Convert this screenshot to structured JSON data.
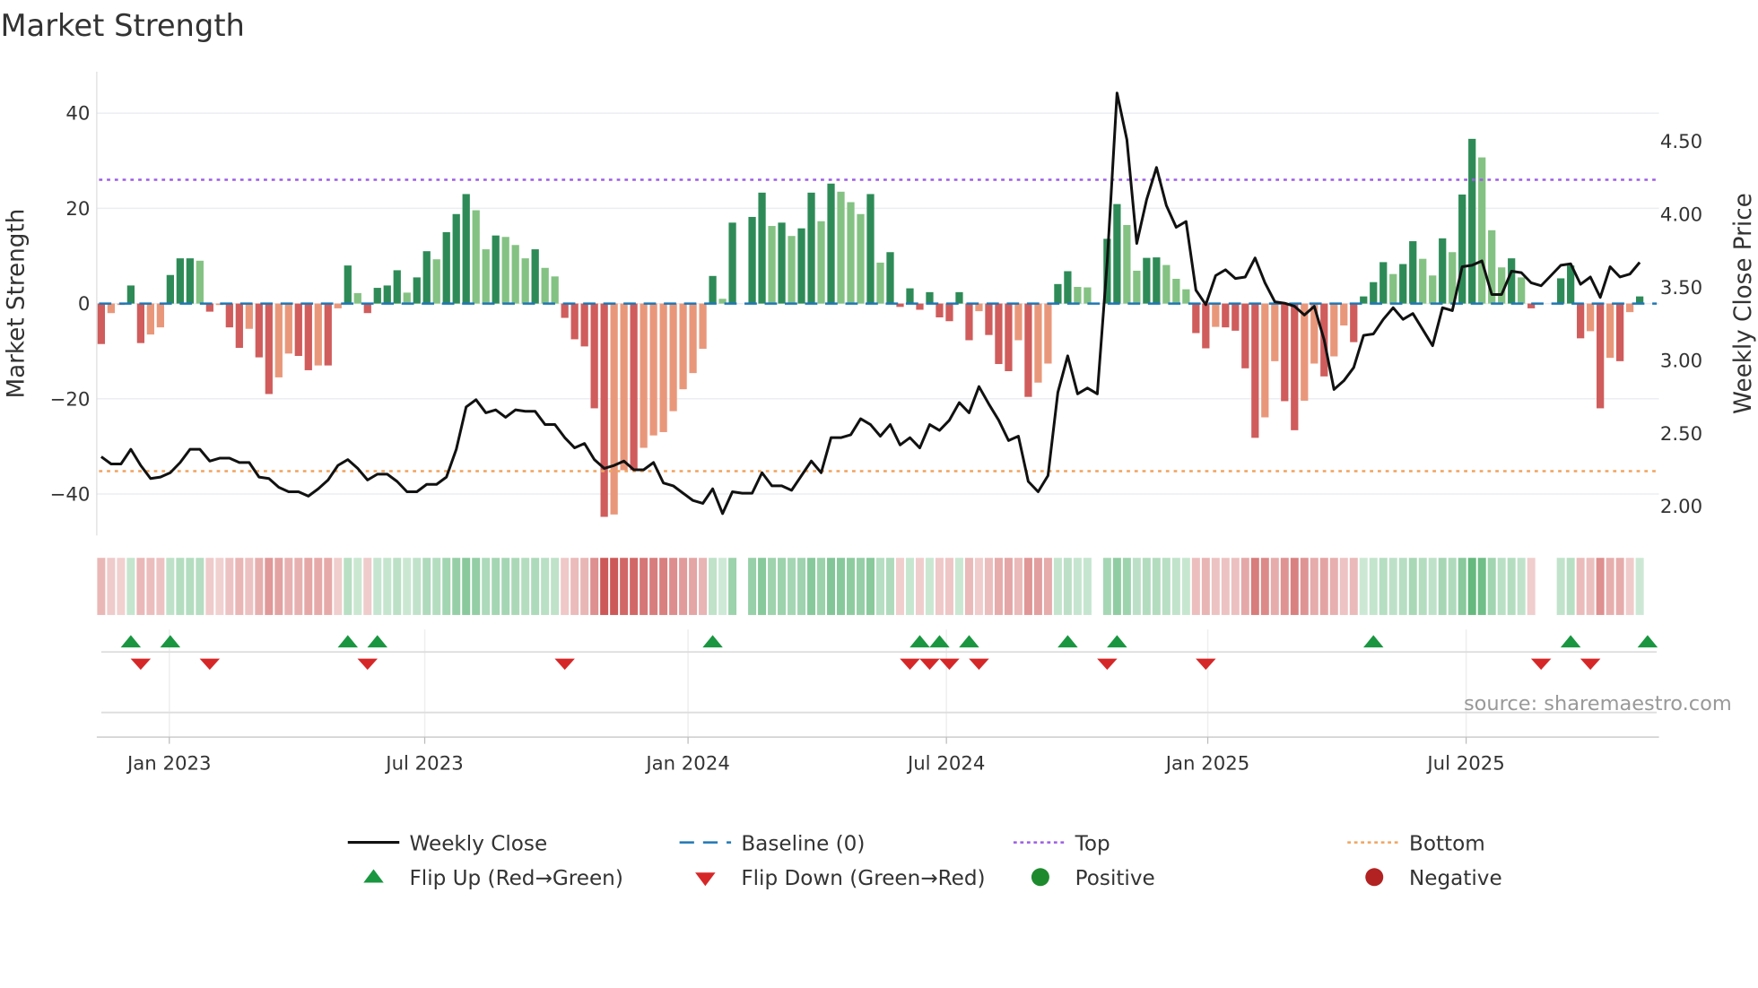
{
  "title": "Market Strength",
  "source": "source: sharemaestro.com",
  "chart_data": {
    "type": "bar+line",
    "title": "Market Strength",
    "ylabel_left": "Market Strength",
    "ylabel_right": "Weekly Close Price",
    "ylim_left": [
      -48.7,
      48.7
    ],
    "ylim_right": [
      1.8,
      4.98
    ],
    "yticks_left": [
      {
        "v": 40,
        "label": "40"
      },
      {
        "v": 20,
        "label": "20"
      },
      {
        "v": 0,
        "label": "0"
      },
      {
        "v": -20,
        "label": "−20"
      },
      {
        "v": -40,
        "label": "−40"
      }
    ],
    "yticks_right": [
      {
        "v": 4.5,
        "label": "4.50"
      },
      {
        "v": 4.0,
        "label": "4.00"
      },
      {
        "v": 3.5,
        "label": "3.50"
      },
      {
        "v": 3.0,
        "label": "3.00"
      },
      {
        "v": 2.5,
        "label": "2.50"
      },
      {
        "v": 2.0,
        "label": "2.00"
      }
    ],
    "xticks": [
      {
        "week": 6.9,
        "label": "Jan 2023"
      },
      {
        "week": 32.8,
        "label": "Jul 2023"
      },
      {
        "week": 59.5,
        "label": "Jan 2024"
      },
      {
        "week": 85.7,
        "label": "Jul 2024"
      },
      {
        "week": 112.2,
        "label": "Jan 2025"
      },
      {
        "week": 138.4,
        "label": "Jul 2025"
      }
    ],
    "top": 26,
    "bottom": -35.2,
    "baseline": 0,
    "strength": [
      -8.5,
      -2,
      -0.3,
      3.8,
      -8.3,
      -6.5,
      -5,
      6,
      9.5,
      9.5,
      9,
      -1.7,
      -0.3,
      -5,
      -9.3,
      -5.3,
      -11.3,
      -19,
      -15.5,
      -10.5,
      -11,
      -14,
      -13,
      -13,
      -1,
      8,
      2.2,
      -2,
      3.3,
      3.8,
      7,
      2.3,
      5.5,
      11,
      9.3,
      15,
      18.8,
      23,
      19.6,
      11.4,
      14.3,
      14,
      12.3,
      9.5,
      11.4,
      7.5,
      5.7,
      -3,
      -7.5,
      -9,
      -22,
      -44.8,
      -44.3,
      -35,
      -35,
      -30.3,
      -27.7,
      -27,
      -22.6,
      -18,
      -14.6,
      -9.5,
      5.8,
      1,
      17,
      0,
      18.2,
      23.3,
      16.3,
      17,
      14.2,
      15.8,
      23.3,
      17.3,
      25.2,
      23.5,
      21.3,
      18.8,
      23,
      8.6,
      10.8,
      -0.7,
      3.2,
      -1.3,
      2.4,
      -2.9,
      -3.7,
      2.4,
      -7.7,
      -1.6,
      -6.6,
      -12.7,
      -14.2,
      -7.7,
      -19.6,
      -16.6,
      -12.6,
      4.1,
      6.8,
      3.5,
      3.4,
      0,
      13.6,
      20.9,
      16.5,
      6.9,
      9.6,
      9.7,
      8.1,
      5.2,
      3,
      -6.2,
      -9.4,
      -4.9,
      -5,
      -5.7,
      -13.6,
      -28.2,
      -23.9,
      -12.1,
      -20.5,
      -26.6,
      -20.4,
      -12.6,
      -15.3,
      -11.1,
      -4.6,
      -8.1,
      1.5,
      4.5,
      8.7,
      6.2,
      8.3,
      13.1,
      9.4,
      5.9,
      13.7,
      10.8,
      22.9,
      34.6,
      30.7,
      15.4,
      7.6,
      9.5,
      5.5,
      -1,
      0,
      0,
      5.3,
      8,
      -7.3,
      -5.8,
      -22,
      -11.4,
      -12.1,
      -1.8,
      1.5
    ],
    "close": [
      2.34,
      2.29,
      2.29,
      2.39,
      2.28,
      2.19,
      2.2,
      2.23,
      2.3,
      2.39,
      2.39,
      2.31,
      2.33,
      2.33,
      2.3,
      2.3,
      2.2,
      2.19,
      2.13,
      2.1,
      2.1,
      2.07,
      2.12,
      2.18,
      2.28,
      2.32,
      2.26,
      2.18,
      2.22,
      2.22,
      2.17,
      2.1,
      2.1,
      2.15,
      2.15,
      2.2,
      2.39,
      2.68,
      2.73,
      2.64,
      2.66,
      2.61,
      2.66,
      2.65,
      2.65,
      2.56,
      2.56,
      2.47,
      2.4,
      2.43,
      2.32,
      2.26,
      2.28,
      2.31,
      2.25,
      2.25,
      2.3,
      2.16,
      2.14,
      2.09,
      2.04,
      2.02,
      2.12,
      1.95,
      2.1,
      2.09,
      2.09,
      2.23,
      2.14,
      2.14,
      2.11,
      2.21,
      2.31,
      2.23,
      2.47,
      2.47,
      2.49,
      2.6,
      2.56,
      2.48,
      2.56,
      2.42,
      2.47,
      2.4,
      2.56,
      2.52,
      2.59,
      2.71,
      2.64,
      2.82,
      2.7,
      2.59,
      2.45,
      2.48,
      2.17,
      2.1,
      2.21,
      2.78,
      3.03,
      2.77,
      2.81,
      2.77,
      3.67,
      4.83,
      4.51,
      3.8,
      4.1,
      4.32,
      4.06,
      3.91,
      3.95,
      3.48,
      3.38,
      3.58,
      3.62,
      3.56,
      3.57,
      3.7,
      3.53,
      3.4,
      3.39,
      3.37,
      3.31,
      3.37,
      3.14,
      2.8,
      2.86,
      2.95,
      3.17,
      3.18,
      3.28,
      3.36,
      3.28,
      3.32,
      3.21,
      3.1,
      3.36,
      3.34,
      3.64,
      3.65,
      3.68,
      3.45,
      3.45,
      3.61,
      3.6,
      3.53,
      3.51,
      3.58,
      3.65,
      3.66,
      3.52,
      3.57,
      3.43,
      3.64,
      3.57,
      3.59,
      3.67
    ],
    "flip_up_weeks": [
      3,
      7,
      25,
      28,
      62,
      83,
      85,
      88,
      98,
      103,
      129,
      149,
      156.8
    ],
    "flip_down_weeks": [
      4,
      11,
      27,
      47,
      82,
      84,
      86,
      89,
      102,
      112,
      146,
      151
    ],
    "colors": {
      "pos_strong": "#2e8b57",
      "pos_fading": "#84c283",
      "neg_strong": "#d05c5c",
      "neg_fading": "#e9977b",
      "baseline": "#1f77b4",
      "top": "#9b5de5",
      "bottom": "#f0a35e",
      "line": "#111111",
      "flip_up": "#1a9641",
      "flip_down": "#d62728",
      "positive": "#1e8a2e",
      "negative": "#b22222"
    },
    "legend": [
      {
        "label": "Weekly Close",
        "type": "line"
      },
      {
        "label": "Baseline (0)",
        "type": "dash"
      },
      {
        "label": "Top",
        "type": "dot-top"
      },
      {
        "label": "Bottom",
        "type": "dot-bottom"
      },
      {
        "label": "Flip Up (Red→Green)",
        "type": "tri-up"
      },
      {
        "label": "Flip Down (Green→Red)",
        "type": "tri-down"
      },
      {
        "label": "Positive",
        "type": "circle-pos"
      },
      {
        "label": "Negative",
        "type": "circle-neg"
      }
    ],
    "legend_placement": "bottom"
  }
}
